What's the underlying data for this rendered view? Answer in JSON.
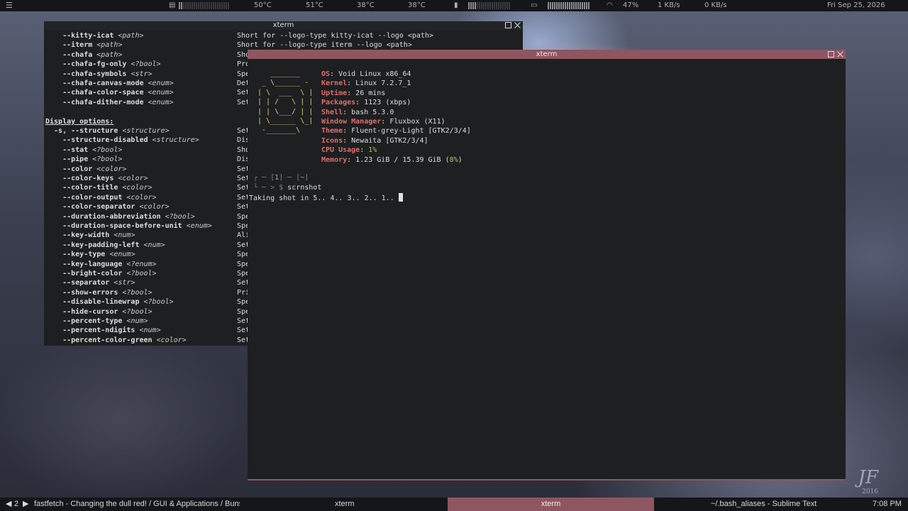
{
  "colors": {
    "accent": "#8e5660",
    "terminal_bg": "#1d1f21",
    "key": "#e06d6d",
    "logo": "#e2d27a",
    "percent": "#b5bd68",
    "bar_bg": "#15161a"
  },
  "topbar": {
    "temps": [
      "50°C",
      "51°C",
      "38°C",
      "38°C"
    ],
    "battery": "47%",
    "net_up": "1 KB/s",
    "net_down": "0 KB/s",
    "date": "Fri Sep 25, 2026",
    "icons": [
      "menu-icon",
      "cpu-icon",
      "memory-icon",
      "battery-icon",
      "wifi-icon"
    ]
  },
  "window_back": {
    "title": "xterm",
    "rows": [
      {
        "indent": "    ",
        "flag": "--kitty-icat",
        "arg": "<path>",
        "desc": "Short for --logo-type kitty-icat --logo <path>"
      },
      {
        "indent": "    ",
        "flag": "--iterm",
        "arg": "<path>",
        "desc": "Short for --logo-type iterm --logo <path>"
      },
      {
        "indent": "    ",
        "flag": "--chafa",
        "arg": "<path>",
        "desc": "Sho"
      },
      {
        "indent": "    ",
        "flag": "--chafa-fg-only",
        "arg": "<?bool>",
        "desc": "Pro"
      },
      {
        "indent": "    ",
        "flag": "--chafa-symbols",
        "arg": "<str>",
        "desc": "Spe"
      },
      {
        "indent": "    ",
        "flag": "--chafa-canvas-mode",
        "arg": "<enum>",
        "desc": "Det"
      },
      {
        "indent": "    ",
        "flag": "--chafa-color-space",
        "arg": "<enum>",
        "desc": "Set"
      },
      {
        "indent": "    ",
        "flag": "--chafa-dither-mode",
        "arg": "<enum>",
        "desc": "Set"
      },
      {
        "indent": "",
        "flag": "",
        "arg": "",
        "desc": ""
      },
      {
        "header": "Display options:"
      },
      {
        "indent": "  -s, ",
        "flag": "--structure",
        "arg": "<structure>",
        "desc": "Set"
      },
      {
        "indent": "    ",
        "flag": "--structure-disabled",
        "arg": "<structure>",
        "desc": "Dis"
      },
      {
        "indent": "    ",
        "flag": "--stat",
        "arg": "<?bool>",
        "desc": "Sho"
      },
      {
        "indent": "    ",
        "flag": "--pipe",
        "arg": "<?bool>",
        "desc": "Dis"
      },
      {
        "indent": "    ",
        "flag": "--color",
        "arg": "<color>",
        "desc": "Set"
      },
      {
        "indent": "    ",
        "flag": "--color-keys",
        "arg": "<color>",
        "desc": "Set"
      },
      {
        "indent": "    ",
        "flag": "--color-title",
        "arg": "<color>",
        "desc": "Set"
      },
      {
        "indent": "    ",
        "flag": "--color-output",
        "arg": "<color>",
        "desc": "Set"
      },
      {
        "indent": "    ",
        "flag": "--color-separator",
        "arg": "<color>",
        "desc": "Set"
      },
      {
        "indent": "    ",
        "flag": "--duration-abbreviation",
        "arg": "<?bool>",
        "desc": "Spe"
      },
      {
        "indent": "    ",
        "flag": "--duration-space-before-unit",
        "arg": "<enum>",
        "desc": "Spe"
      },
      {
        "indent": "    ",
        "flag": "--key-width",
        "arg": "<num>",
        "desc": "Ali"
      },
      {
        "indent": "    ",
        "flag": "--key-padding-left",
        "arg": "<num>",
        "desc": "Set"
      },
      {
        "indent": "    ",
        "flag": "--key-type",
        "arg": "<enum>",
        "desc": "Spe"
      },
      {
        "indent": "    ",
        "flag": "--key-language",
        "arg": "<?enum>",
        "desc": "Spe"
      },
      {
        "indent": "    ",
        "flag": "--bright-color",
        "arg": "<?bool>",
        "desc": "Spe"
      },
      {
        "indent": "    ",
        "flag": "--separator",
        "arg": "<str>",
        "desc": "Set"
      },
      {
        "indent": "    ",
        "flag": "--show-errors",
        "arg": "<?bool>",
        "desc": "Pri"
      },
      {
        "indent": "    ",
        "flag": "--disable-linewrap",
        "arg": "<?bool>",
        "desc": "Spe"
      },
      {
        "indent": "    ",
        "flag": "--hide-cursor",
        "arg": "<?bool>",
        "desc": "Spe"
      },
      {
        "indent": "    ",
        "flag": "--percent-type",
        "arg": "<num>",
        "desc": "Set"
      },
      {
        "indent": "    ",
        "flag": "--percent-ndigits",
        "arg": "<num>",
        "desc": "Set"
      },
      {
        "indent": "    ",
        "flag": "--percent-color-green",
        "arg": "<color>",
        "desc": "Set"
      }
    ]
  },
  "window_front": {
    "title": "xterm",
    "logo": "   _______\n _ \\______ -\n| \\  ___  \\ |\n| | /   \\ | |\n| | \\___/ | |\n| \\______ \\_|\n -_______\\",
    "info": [
      {
        "key": "OS",
        "value": "Void Linux x86_64"
      },
      {
        "key": "Kernel",
        "value": "Linux 7.2.7_1"
      },
      {
        "key": "Uptime",
        "value": "26 mins"
      },
      {
        "key": "Packages",
        "value": "1123 (xbps)"
      },
      {
        "key": "Shell",
        "value": "bash 5.3.0"
      },
      {
        "key": "Window Manager",
        "value": "Fluxbox (X11)"
      },
      {
        "key": "Theme",
        "value": "Fluent-grey-Light [GTK2/3/4]"
      },
      {
        "key": "Icons",
        "value": "Newaita [GTK2/3/4]"
      },
      {
        "key": "CPU Usage",
        "value": "",
        "pct": "1%"
      },
      {
        "key": "Memory",
        "value": "1.23 GiB / 15.39 GiB (",
        "pct": "8%",
        "tail": ")"
      }
    ],
    "prompt_line1_a": "┌ ─ [",
    "prompt_num": "1",
    "prompt_line1_b": "] ─ [",
    "prompt_dir": "~",
    "prompt_line1_c": "]",
    "prompt_line2": "└ ─ > $ ",
    "command": "scrnshot",
    "output": "Taking shot in 5.. 4.. 3.. 2.. 1.. "
  },
  "taskbar": {
    "workspace": "2",
    "items": [
      "fastfetch - Changing the dull red! / GUI & Applications / BunsenL",
      "xterm",
      "xterm",
      "~/.bash_aliases - Sublime Text"
    ],
    "clock": "7:08 PM"
  },
  "wallpaper": {
    "signature": "JF",
    "year": "2016"
  }
}
